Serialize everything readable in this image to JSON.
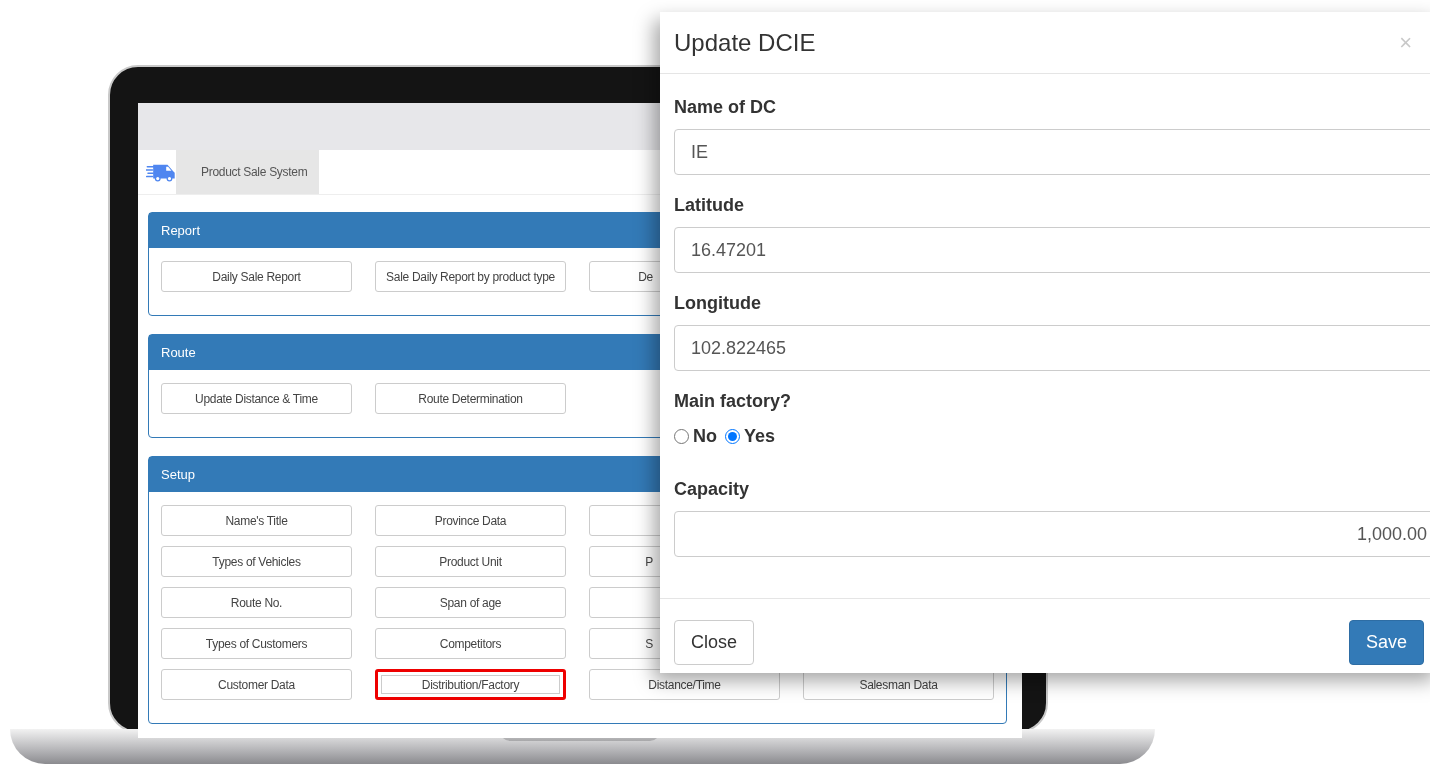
{
  "screen": {
    "app_title": "Product Sale System"
  },
  "panels": [
    {
      "title": "Report",
      "rows": [
        [
          {
            "kind": "button",
            "label": "Daily Sale Report",
            "highlighted": false
          },
          {
            "kind": "button",
            "label": "Sale Daily Report by product type",
            "highlighted": false
          },
          {
            "kind": "cut",
            "label": "De",
            "highlighted": false
          }
        ]
      ]
    },
    {
      "title": "Route",
      "rows": [
        [
          {
            "kind": "button",
            "label": "Update Distance & Time",
            "highlighted": false
          },
          {
            "kind": "button",
            "label": "Route Determination",
            "highlighted": false
          }
        ]
      ]
    },
    {
      "title": "Setup",
      "rows": [
        [
          {
            "kind": "button",
            "label": "Name's Title",
            "highlighted": false
          },
          {
            "kind": "button",
            "label": "Province Data",
            "highlighted": false
          },
          {
            "kind": "covered",
            "highlighted": false
          }
        ],
        [
          {
            "kind": "button",
            "label": "Types of Vehicles",
            "highlighted": false
          },
          {
            "kind": "button",
            "label": "Product Unit",
            "highlighted": false
          },
          {
            "kind": "cut",
            "label": "P",
            "highlighted": false
          }
        ],
        [
          {
            "kind": "button",
            "label": "Route No.",
            "highlighted": false
          },
          {
            "kind": "button",
            "label": "Span of age",
            "highlighted": false
          },
          {
            "kind": "covered",
            "highlighted": false
          }
        ],
        [
          {
            "kind": "button",
            "label": "Types of Customers",
            "highlighted": false
          },
          {
            "kind": "button",
            "label": "Competitors",
            "highlighted": false
          },
          {
            "kind": "cut",
            "label": "S",
            "highlighted": false
          }
        ],
        [
          {
            "kind": "button",
            "label": "Customer Data",
            "highlighted": false
          },
          {
            "kind": "button",
            "label": "Distribution/Factory",
            "highlighted": true
          },
          {
            "kind": "button",
            "label": "Distance/Time",
            "highlighted": false
          },
          {
            "kind": "button",
            "label": "Salesman Data",
            "highlighted": false
          }
        ]
      ]
    }
  ],
  "modal": {
    "title": "Update DCIE",
    "close": "×",
    "body": [
      {
        "kind": "text",
        "label": "Name of DC",
        "value": "IE"
      },
      {
        "kind": "text",
        "label": "Latitude",
        "value": "16.47201"
      },
      {
        "kind": "text",
        "label": "Longitude",
        "value": "102.822465"
      },
      {
        "kind": "radio",
        "label": "Main factory?",
        "options": [
          {
            "label": "No",
            "selected": false
          },
          {
            "label": "Yes",
            "selected": true
          }
        ]
      },
      {
        "kind": "number",
        "label": "Capacity",
        "value": "1,000.00"
      }
    ],
    "footer": [
      {
        "kind": "secondary",
        "label": "Close"
      },
      {
        "kind": "primary",
        "label": "Save"
      }
    ]
  }
}
